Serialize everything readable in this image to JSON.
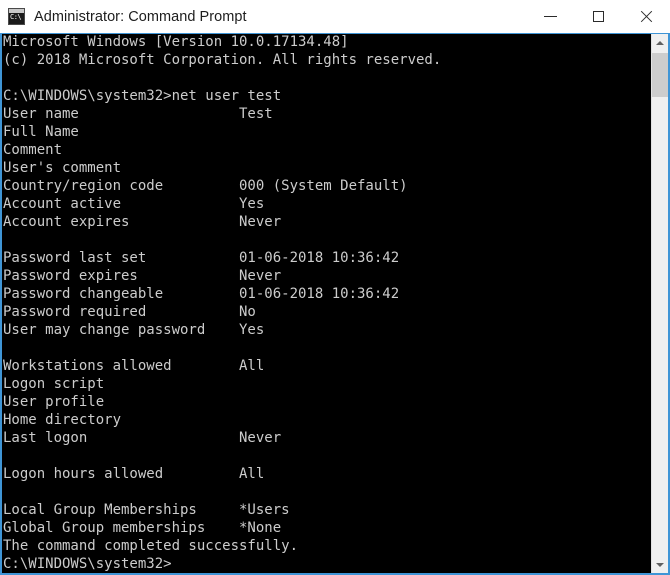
{
  "window": {
    "title": "Administrator: Command Prompt",
    "icon": "command-prompt-icon",
    "icon_glyph": "C:\\",
    "accent_border_color": "#3f95d6",
    "titlebar_bg": "#ffffff",
    "console_bg": "#000000",
    "console_fg": "#cccccc"
  },
  "controls": {
    "minimize_label": "Minimize",
    "maximize_label": "Maximize",
    "close_label": "Close"
  },
  "scrollbar": {
    "up_label": "Scroll up",
    "down_label": "Scroll down",
    "thumb_label": "Scroll thumb"
  },
  "console": {
    "banner": [
      "Microsoft Windows [Version 10.0.17134.48]",
      "(c) 2018 Microsoft Corporation. All rights reserved."
    ],
    "prompt": "C:\\WINDOWS\\system32>",
    "command": "net user test",
    "fields": [
      {
        "label": "User name",
        "value": "Test"
      },
      {
        "label": "Full Name",
        "value": ""
      },
      {
        "label": "Comment",
        "value": ""
      },
      {
        "label": "User's comment",
        "value": ""
      },
      {
        "label": "Country/region code",
        "value": "000 (System Default)"
      },
      {
        "label": "Account active",
        "value": "Yes"
      },
      {
        "label": "Account expires",
        "value": "Never"
      },
      {
        "label": "",
        "value": ""
      },
      {
        "label": "Password last set",
        "value": "01-06-2018 10:36:42"
      },
      {
        "label": "Password expires",
        "value": "Never"
      },
      {
        "label": "Password changeable",
        "value": "01-06-2018 10:36:42"
      },
      {
        "label": "Password required",
        "value": "No"
      },
      {
        "label": "User may change password",
        "value": "Yes"
      },
      {
        "label": "",
        "value": ""
      },
      {
        "label": "Workstations allowed",
        "value": "All"
      },
      {
        "label": "Logon script",
        "value": ""
      },
      {
        "label": "User profile",
        "value": ""
      },
      {
        "label": "Home directory",
        "value": ""
      },
      {
        "label": "Last logon",
        "value": "Never"
      },
      {
        "label": "",
        "value": ""
      },
      {
        "label": "Logon hours allowed",
        "value": "All"
      },
      {
        "label": "",
        "value": ""
      },
      {
        "label": "Local Group Memberships",
        "value": "*Users"
      },
      {
        "label": "Global Group memberships",
        "value": "*None"
      }
    ],
    "status": "The command completed successfully.",
    "value_column": 28
  }
}
